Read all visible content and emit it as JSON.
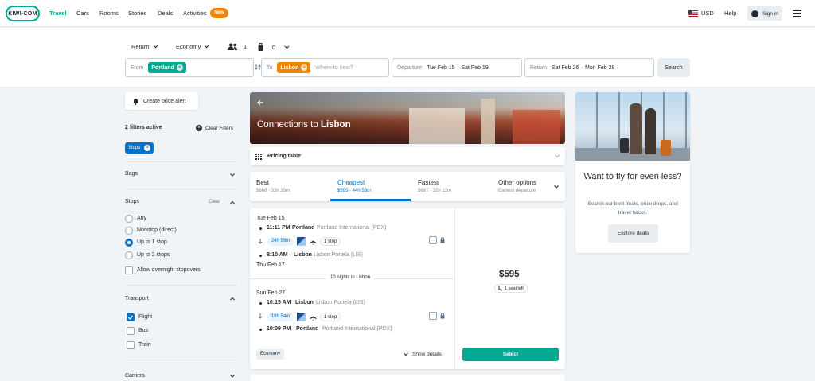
{
  "header": {
    "logo": "KIWI·COM",
    "nav": [
      "Travel",
      "Cars",
      "Rooms",
      "Stories",
      "Deals",
      "Activities"
    ],
    "new_badge": "New",
    "currency": "USD",
    "help": "Help",
    "sign_in": "Sign in"
  },
  "search": {
    "trip_type": "Return",
    "cabin": "Economy",
    "passengers": "1",
    "bags": "0",
    "from_label": "From",
    "from_value": "Portland",
    "to_label": "To",
    "to_value": "Lisbon",
    "to_placeholder": "Where to next?",
    "departure_label": "Departure",
    "departure_value": "Tue Feb 15 – Sat Feb 19",
    "return_label": "Return",
    "return_value": "Sat Feb 26 – Mon Feb 28",
    "search_button": "Search"
  },
  "sidebar": {
    "price_alert": "Create price alert",
    "filters_active": "2 filters active",
    "clear_filters": "Clear Filters",
    "active_filter_chip": "Stops",
    "bags_heading": "Bags",
    "stops_heading": "Stops",
    "stops_clear": "Clear",
    "stops_options": [
      "Any",
      "Nonstop (direct)",
      "Up to 1 stop",
      "Up to 2 stops"
    ],
    "overnight": "Allow overnight stopovers",
    "transport_heading": "Transport",
    "transport_options": [
      "Flight",
      "Bus",
      "Train"
    ],
    "carriers_heading": "Carriers"
  },
  "main": {
    "banner_title_prefix": "Connections to ",
    "banner_title_city": "Lisbon",
    "pricing_table": "Pricing table",
    "tabs": [
      {
        "label": "Best",
        "sub": "$668 · 33h 15m"
      },
      {
        "label": "Cheapest",
        "sub": "$595 · 44h 53m"
      },
      {
        "label": "Fastest",
        "sub": "$687 · 32h 12m"
      },
      {
        "label": "Other options",
        "sub": "Earliest departure"
      }
    ],
    "result": {
      "outbound_date": "Tue Feb 15",
      "outbound_dep_time": "11:11 PM",
      "outbound_dep_city": "Portland",
      "outbound_dep_airport": "Portland International (PDX)",
      "outbound_duration": "24h 59m",
      "outbound_stops": "1 stop",
      "outbound_arr_time": "8:10 AM",
      "outbound_arr_city": "Lisbon",
      "outbound_arr_airport": "Lisbon Portela (LIS)",
      "outbound_arr_date": "Thu Feb 17",
      "nights": "10 nights in Lisbon",
      "inbound_date": "Sun Feb 27",
      "inbound_dep_time": "10:15 AM",
      "inbound_dep_city": "Lisbon",
      "inbound_dep_airport": "Lisbon Portela (LIS)",
      "inbound_duration": "19h 54m",
      "inbound_stops": "1 stop",
      "inbound_arr_time": "10:09 PM",
      "inbound_arr_city": "Portland",
      "inbound_arr_airport": "Portland International (PDX)",
      "fare": "Economy",
      "show_details": "Show details",
      "price": "$595",
      "seats": "1 seat left",
      "select": "Select"
    }
  },
  "promo": {
    "title": "Want to fly for even less?",
    "body": "Search our best deals, price drops, and travel hacks.",
    "button": "Explore deals"
  },
  "colors": {
    "brand": "#00a991",
    "accent_orange": "#ed8600",
    "selected_blue": "#0172cb"
  }
}
